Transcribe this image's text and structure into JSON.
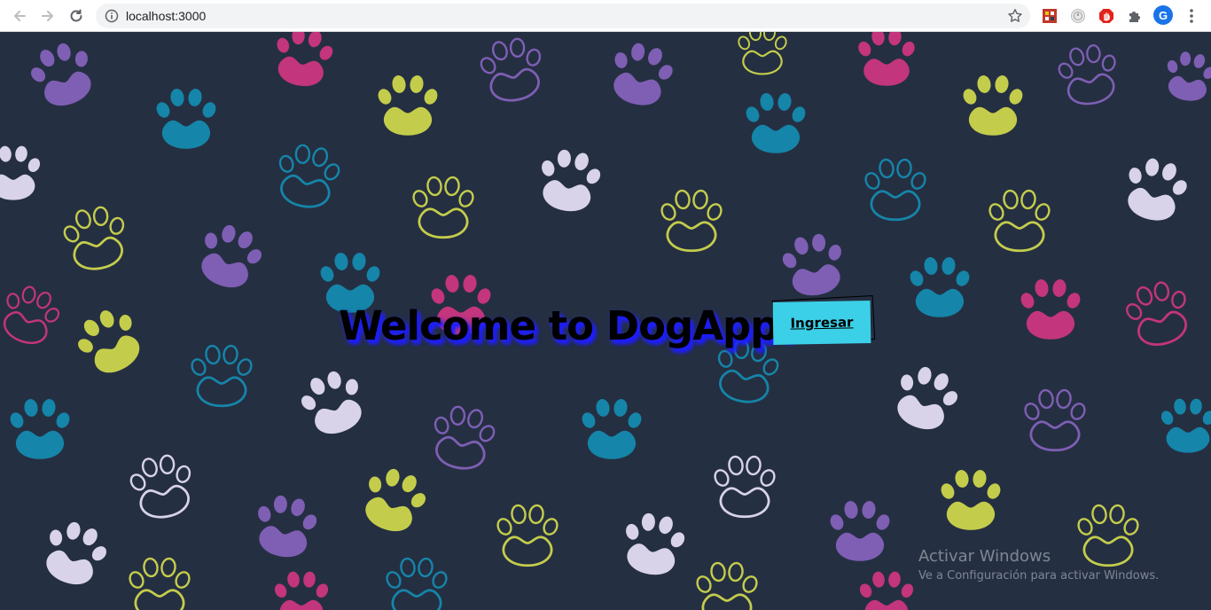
{
  "browser": {
    "url": "localhost:3000",
    "profile_initial": "G",
    "extensions": [
      "pixel-art-extension-icon",
      "clock-extension-icon",
      "adblock-stop-icon",
      "puzzle-icon"
    ]
  },
  "page": {
    "title": "Welcome to DogApp!",
    "enter_button": "Ingresar",
    "background_color": "#252f42",
    "accent_color": "#3bd0e8",
    "paw_colors": [
      "#7e5fb4",
      "#c3357d",
      "#c4cd4b",
      "#1585a9",
      "#d8d3e8"
    ]
  },
  "watermark": {
    "title": "Activar Windows",
    "subtitle": "Ve a Configuración para activar Windows."
  }
}
